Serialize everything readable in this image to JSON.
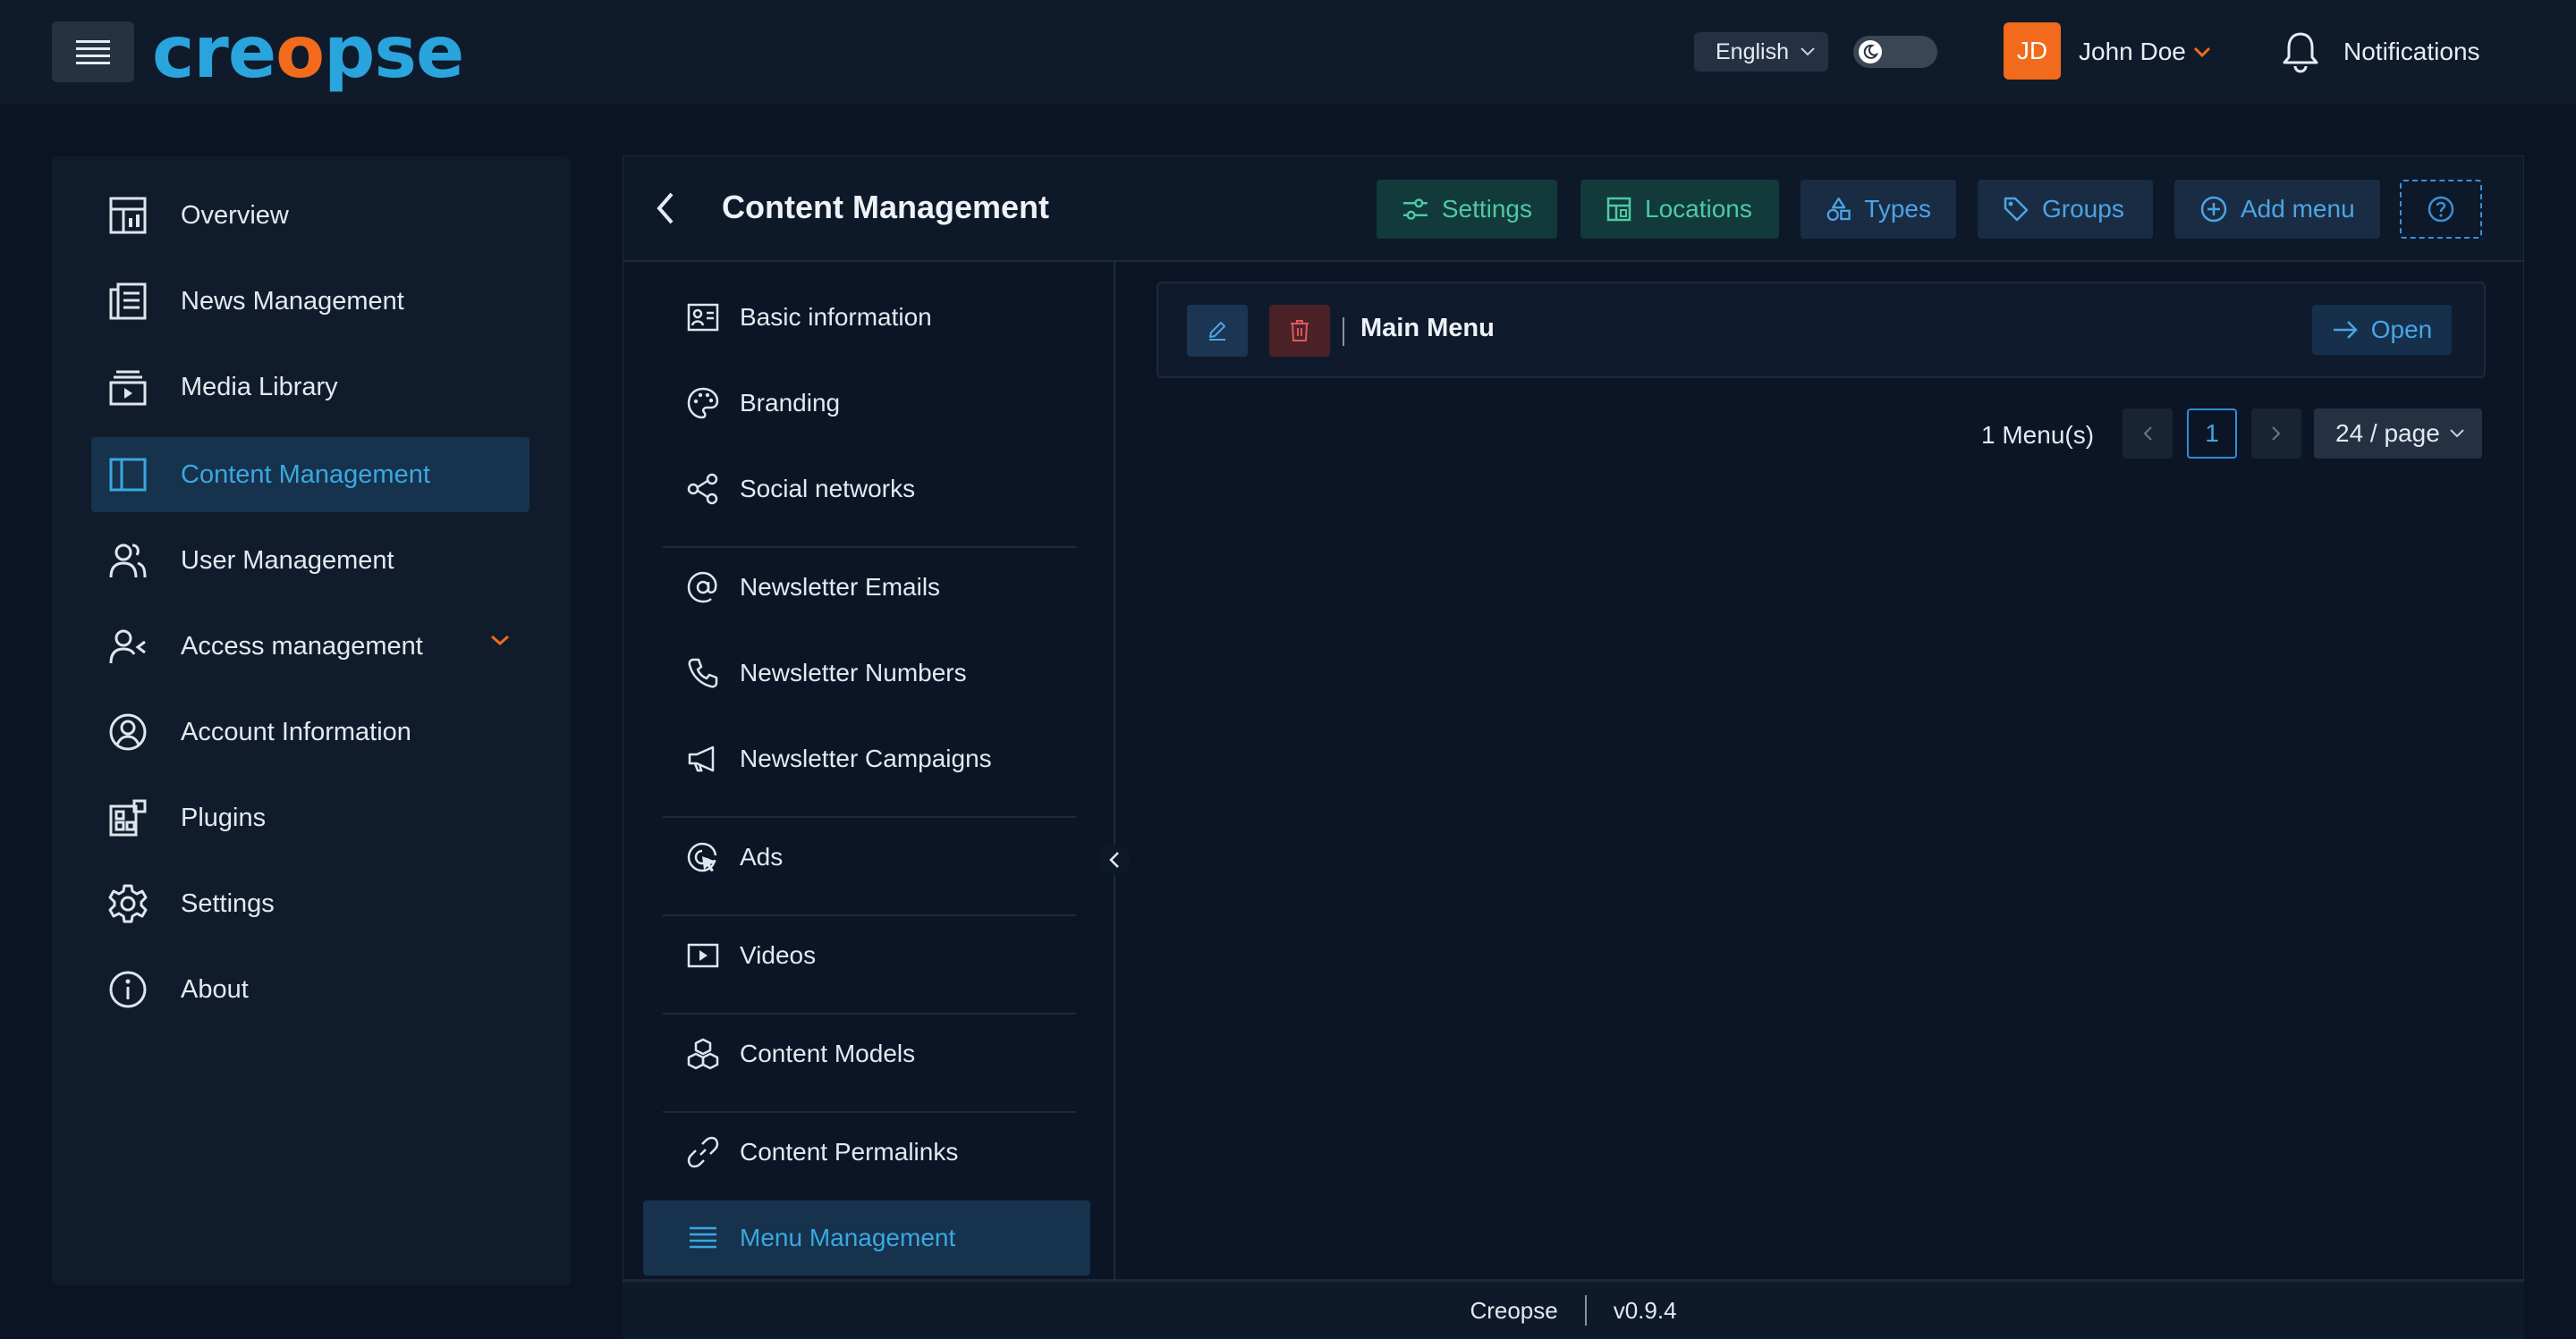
{
  "app": {
    "logo_text_a": "cre",
    "logo_text_b": "o",
    "logo_text_c": "pse"
  },
  "header": {
    "language": "English",
    "avatar_initials": "JD",
    "user_name": "John Doe",
    "notifications_label": "Notifications"
  },
  "sidebar": {
    "items": [
      {
        "label": "Overview",
        "icon": "dashboard-icon"
      },
      {
        "label": "News Management",
        "icon": "news-icon"
      },
      {
        "label": "Media Library",
        "icon": "media-icon"
      },
      {
        "label": "Content Management",
        "icon": "layout-icon",
        "active": true
      },
      {
        "label": "User Management",
        "icon": "users-icon"
      },
      {
        "label": "Access management",
        "icon": "access-icon",
        "expandable": true
      },
      {
        "label": "Account Information",
        "icon": "account-icon"
      },
      {
        "label": "Plugins",
        "icon": "plugins-icon"
      },
      {
        "label": "Settings",
        "icon": "gear-icon"
      },
      {
        "label": "About",
        "icon": "info-icon"
      }
    ]
  },
  "panel": {
    "title": "Content Management",
    "buttons": {
      "settings": "Settings",
      "locations": "Locations",
      "types": "Types",
      "groups": "Groups",
      "add_menu": "Add menu"
    }
  },
  "subnav": {
    "items": [
      {
        "label": "Basic information",
        "icon": "id-card-icon"
      },
      {
        "label": "Branding",
        "icon": "palette-icon"
      },
      {
        "label": "Social networks",
        "icon": "share-icon"
      },
      {
        "label": "Newsletter Emails",
        "icon": "at-icon"
      },
      {
        "label": "Newsletter Numbers",
        "icon": "phone-icon"
      },
      {
        "label": "Newsletter Campaigns",
        "icon": "megaphone-icon"
      },
      {
        "label": "Ads",
        "icon": "target-icon"
      },
      {
        "label": "Videos",
        "icon": "video-icon"
      },
      {
        "label": "Content Models",
        "icon": "cubes-icon"
      },
      {
        "label": "Content Permalinks",
        "icon": "link-icon"
      },
      {
        "label": "Menu Management",
        "icon": "list-icon",
        "active": true
      }
    ]
  },
  "menus": {
    "items": [
      {
        "title": "Main Menu",
        "open_label": "Open"
      }
    ],
    "count_label": "1 Menu(s)",
    "current_page": "1",
    "page_size": "24 / page"
  },
  "footer": {
    "brand": "Creopse",
    "version": "v0.9.4"
  },
  "colors": {
    "accent": "#2aa4dc",
    "brand_orange": "#f26a1b",
    "bg": "#0a1424"
  }
}
